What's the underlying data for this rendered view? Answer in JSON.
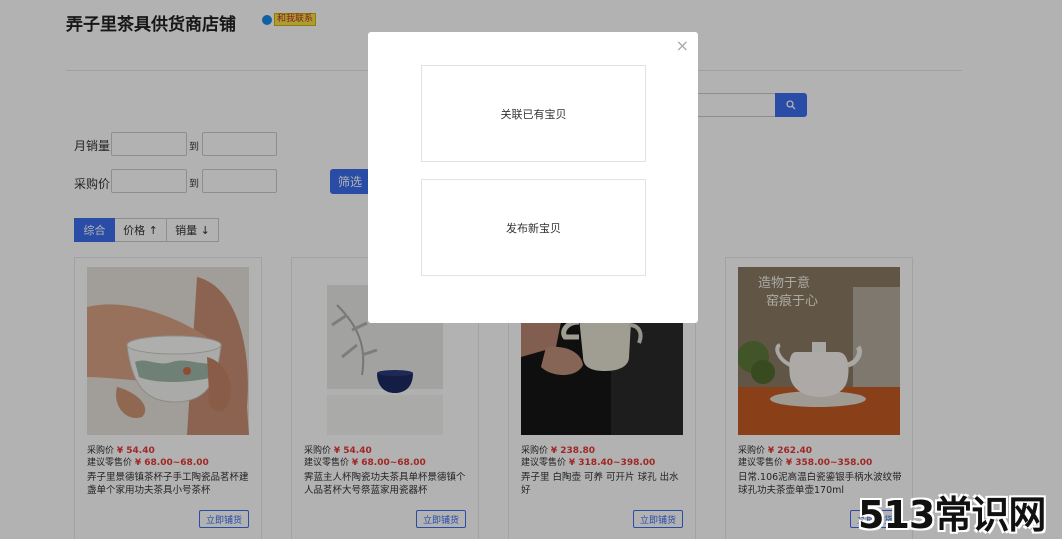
{
  "shop": {
    "title": "弄子里茶具供货商店铺",
    "contact_label": "和我联系"
  },
  "filters": {
    "monthly_sales_label": "月销量",
    "purchase_price_label": "采购价",
    "to_label": "到",
    "filter_button": "筛选"
  },
  "sort_tabs": [
    "综合",
    "价格 ↑",
    "销量 ↓"
  ],
  "products": [
    {
      "price_label": "采购价",
      "price": "¥ 54.40",
      "retail_label": "建议零售价",
      "retail": "¥ 68.00~68.00",
      "name": "弄子里景德镇茶杯子手工陶瓷品茗杯建盏单个家用功夫茶具小号茶杯",
      "button": "立即铺货"
    },
    {
      "price_label": "采购价",
      "price": "¥ 54.40",
      "retail_label": "建议零售价",
      "retail": "¥ 68.00~68.00",
      "name": "霁蓝主人杯陶瓷功夫茶具单杯景德镇个人品茗杯大号祭蓝家用瓷器杯",
      "button": "立即铺货"
    },
    {
      "price_label": "采购价",
      "price": "¥ 238.80",
      "retail_label": "建议零售价",
      "retail": "¥ 318.40~398.00",
      "name": "弄子里 白陶壶 可养 可开片 球孔 出水好",
      "button": "立即铺货"
    },
    {
      "price_label": "采购价",
      "price": "¥ 262.40",
      "retail_label": "建议零售价",
      "retail": "¥ 358.00~358.00",
      "name": "日常.106泥高温白瓷鎏银手柄水波纹带球孔功夫茶壶单壶170ml",
      "button": "立即铺货",
      "image_text": "造物于意 窑痕于心"
    }
  ],
  "modal": {
    "option_link_existing": "关联已有宝贝",
    "option_publish_new": "发布新宝贝",
    "close_symbol": "×"
  },
  "watermark": "513常识网"
}
